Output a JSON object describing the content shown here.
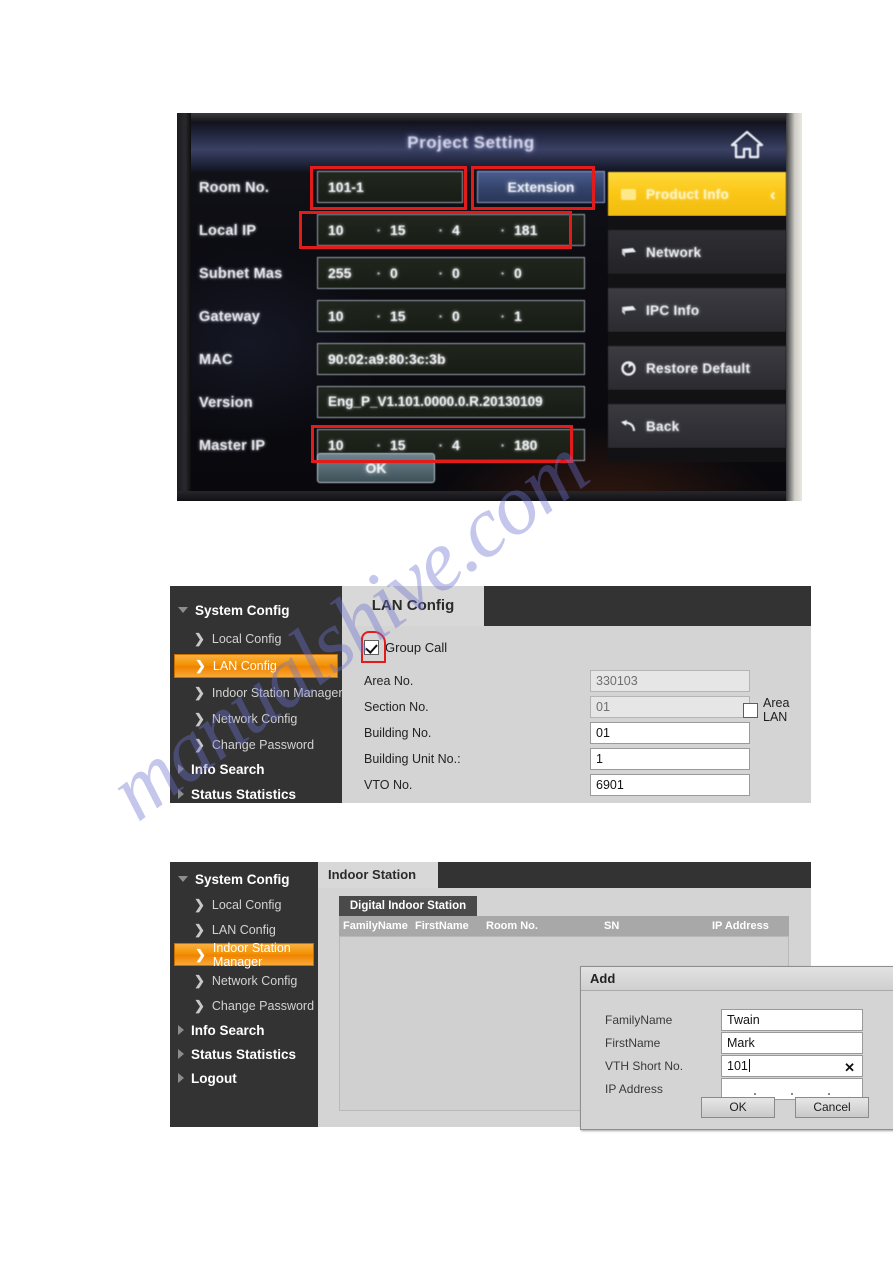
{
  "watermark": {
    "text": "manualshive.com"
  },
  "photo": {
    "title": "Project Setting",
    "home_icon": "home-icon",
    "side_menu": [
      {
        "label": "Product Info",
        "icon": "info-icon",
        "selected": true,
        "chevron": "‹"
      },
      {
        "label": "Network",
        "icon": "network-icon",
        "selected": false
      },
      {
        "label": "IPC Info",
        "icon": "ipc-icon",
        "selected": false
      },
      {
        "label": "Restore Default",
        "icon": "restore-icon",
        "selected": false
      },
      {
        "label": "Back",
        "icon": "back-arrow-icon",
        "selected": false
      }
    ],
    "fields": {
      "room_no": {
        "label": "Room No.",
        "value": "101-1"
      },
      "extension_button": "Extension",
      "local_ip": {
        "label": "Local IP",
        "octets": [
          "10",
          "15",
          "4",
          "181"
        ]
      },
      "subnet_mask": {
        "label": "Subnet Mas",
        "octets": [
          "255",
          "0",
          "0",
          "0"
        ]
      },
      "gateway": {
        "label": "Gateway",
        "octets": [
          "10",
          "15",
          "0",
          "1"
        ]
      },
      "mac": {
        "label": "MAC",
        "value": "90:02:a9:80:3c:3b"
      },
      "version": {
        "label": "Version",
        "value": "Eng_P_V1.101.0000.0.R.20130109"
      },
      "master_ip": {
        "label": "Master IP",
        "octets": [
          "10",
          "15",
          "4",
          "180"
        ]
      }
    },
    "ok_button": "OK",
    "annotation_color": "#e41b1b"
  },
  "lan": {
    "tab_label": "LAN Config",
    "sidebar": {
      "groups": [
        {
          "label": "System Config",
          "expanded": true,
          "items": [
            {
              "label": "Local Config",
              "active": false
            },
            {
              "label": "LAN Config",
              "active": true
            },
            {
              "label": "Indoor Station Manager",
              "active": false
            },
            {
              "label": "Network Config",
              "active": false
            },
            {
              "label": "Change Password",
              "active": false
            }
          ]
        },
        {
          "label": "Info Search",
          "expanded": false,
          "items": []
        },
        {
          "label": "Status Statistics",
          "expanded": false,
          "items": []
        }
      ]
    },
    "group_call": {
      "label": "Group Call",
      "checked": true
    },
    "form": [
      {
        "label": "Area No.",
        "value": "330103",
        "readonly": true
      },
      {
        "label": "Section No.",
        "value": "01",
        "readonly": true
      },
      {
        "label": "Building No.",
        "value": "01",
        "readonly": false
      },
      {
        "label": "Building Unit No.:",
        "value": "1",
        "readonly": false
      },
      {
        "label": "VTO No.",
        "value": "6901",
        "readonly": false
      }
    ],
    "area_lan": {
      "label": "Area LAN",
      "checked": false
    },
    "accent_color": "#f29100"
  },
  "indoor": {
    "tab_label": "Indoor Station",
    "sub_tab_label": "Digital Indoor Station",
    "sidebar": {
      "groups": [
        {
          "label": "System Config",
          "expanded": true,
          "items": [
            {
              "label": "Local Config",
              "active": false
            },
            {
              "label": "LAN Config",
              "active": false
            },
            {
              "label": "Indoor Station Manager",
              "active": true
            },
            {
              "label": "Network Config",
              "active": false
            },
            {
              "label": "Change Password",
              "active": false
            }
          ]
        },
        {
          "label": "Info Search",
          "expanded": false,
          "items": []
        },
        {
          "label": "Status Statistics",
          "expanded": false,
          "items": []
        },
        {
          "label": "Logout",
          "expanded": false,
          "items": []
        }
      ]
    },
    "table": {
      "columns": [
        "FamilyName",
        "FirstName",
        "Room No.",
        "SN",
        "IP Address"
      ],
      "rows": []
    },
    "dialog": {
      "title": "Add",
      "close_icon": "close-icon",
      "fields": [
        {
          "label": "FamilyName",
          "value": "Twain",
          "type": "text"
        },
        {
          "label": "FirstName",
          "value": "Mark",
          "type": "text"
        },
        {
          "label": "VTH Short No.",
          "value": "101",
          "type": "text-with-clear",
          "clear_icon": "clear-x-icon",
          "focused": true
        },
        {
          "label": "IP Address",
          "value": "",
          "type": "ip"
        }
      ],
      "ok_label": "OK",
      "cancel_label": "Cancel"
    }
  }
}
